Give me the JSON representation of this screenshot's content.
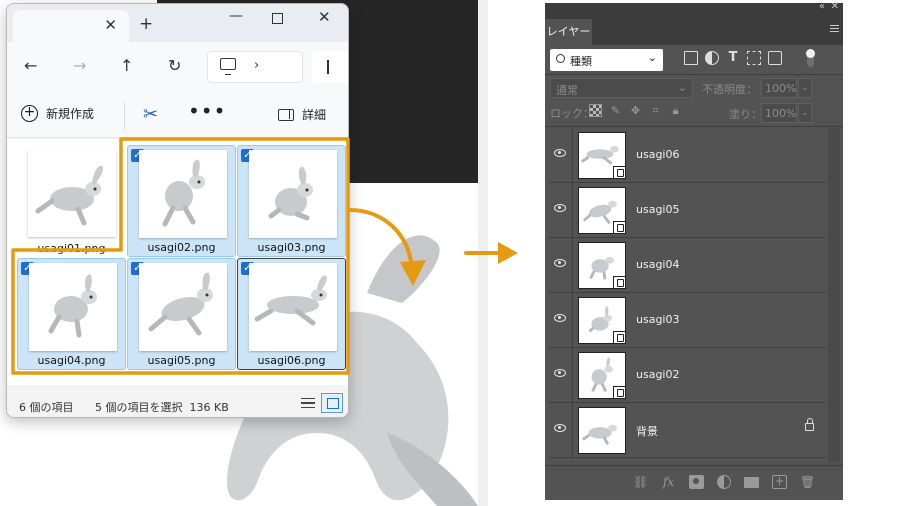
{
  "explorer": {
    "new_button": "新規作成",
    "details_button": "詳細",
    "files": [
      {
        "name": "usagi01.png",
        "selected": false
      },
      {
        "name": "usagi02.png",
        "selected": true
      },
      {
        "name": "usagi03.png",
        "selected": true
      },
      {
        "name": "usagi04.png",
        "selected": true
      },
      {
        "name": "usagi05.png",
        "selected": true
      },
      {
        "name": "usagi06.png",
        "selected": true
      }
    ],
    "status_count": "6 個の項目",
    "status_selected": "5 個の項目を選択",
    "status_size": "136 KB"
  },
  "photoshop": {
    "panel_tab": "レイヤー",
    "filter_label": "種類",
    "blend_mode": "通常",
    "opacity_label": "不透明度：",
    "opacity_value": "100%",
    "lock_label": "ロック：",
    "fill_label": "塗り：",
    "fill_value": "100%",
    "layers": [
      {
        "name": "usagi06",
        "smart": true,
        "locked": false
      },
      {
        "name": "usagi05",
        "smart": true,
        "locked": false
      },
      {
        "name": "usagi04",
        "smart": true,
        "locked": false
      },
      {
        "name": "usagi03",
        "smart": true,
        "locked": false
      },
      {
        "name": "usagi02",
        "smart": true,
        "locked": false
      },
      {
        "name": "背景",
        "smart": false,
        "locked": true
      }
    ]
  },
  "colors": {
    "highlight_orange": "#e59a0f",
    "selection_blue": "#cce4f7",
    "ps_panel": "#535353"
  }
}
